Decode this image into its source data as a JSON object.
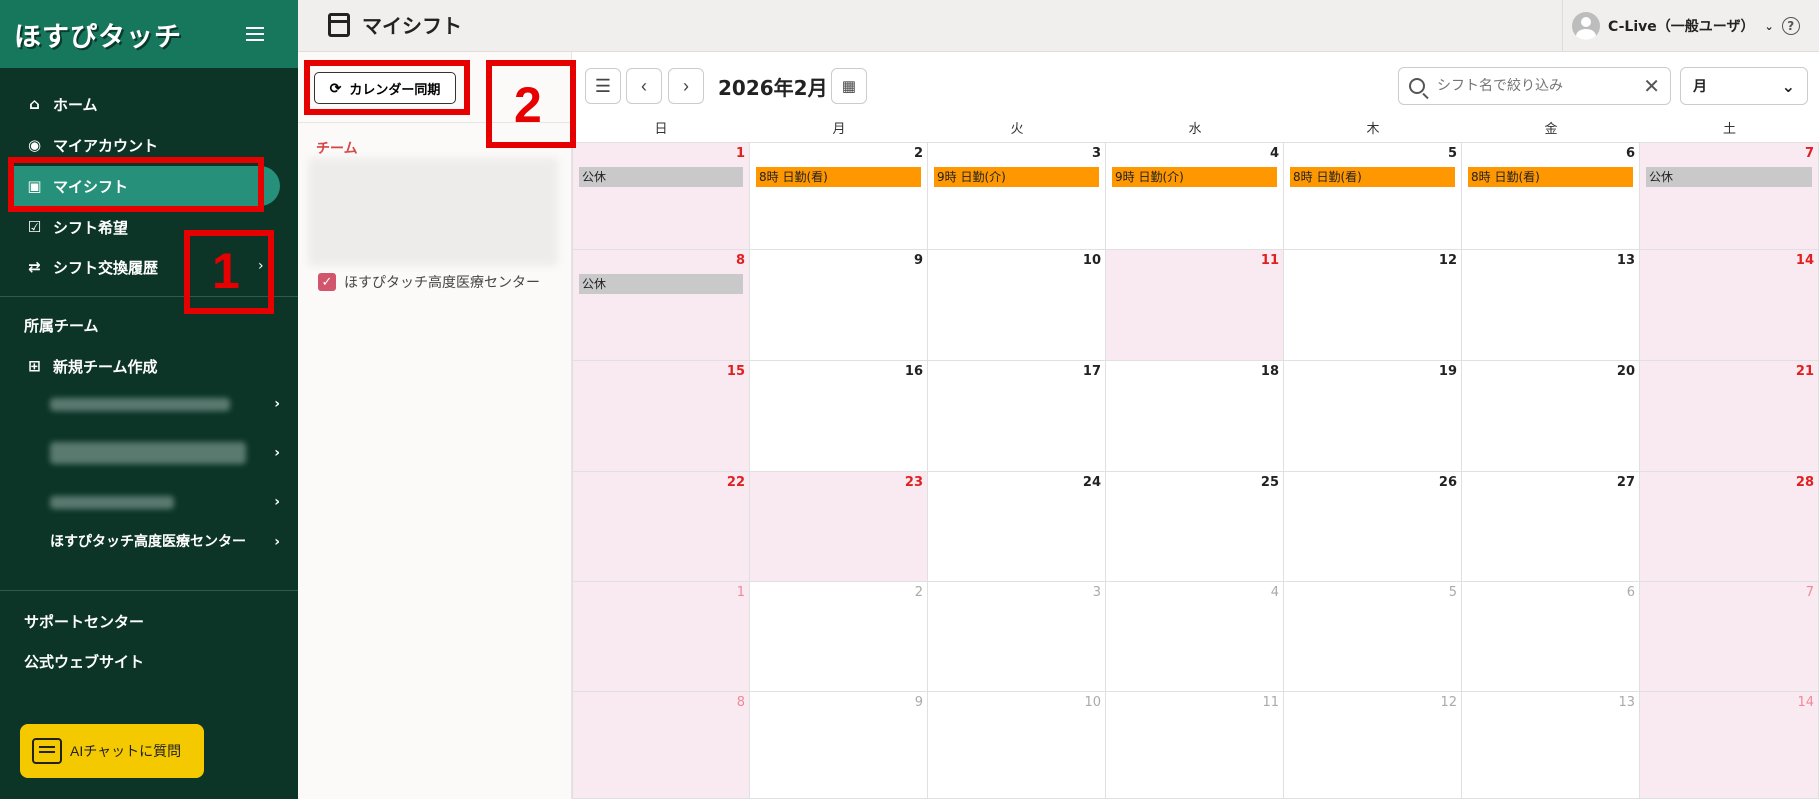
{
  "sidebar": {
    "logo": "ほすぴタッチ",
    "nav": [
      {
        "label": "ホーム",
        "icon": "home-icon"
      },
      {
        "label": "マイアカウント",
        "icon": "account-icon"
      },
      {
        "label": "マイシフト",
        "icon": "id-badge-icon"
      },
      {
        "label": "シフト希望",
        "icon": "checklist-icon"
      },
      {
        "label": "シフト交換履歴",
        "icon": "swap-icon"
      }
    ],
    "team_section": "所属チーム",
    "new_team": "新規チーム作成",
    "teams": [
      "ほすぴタッチ高度医療センター"
    ],
    "support": "サポートセンター",
    "website": "公式ウェブサイト",
    "ai_button": "AIチャットに質問"
  },
  "header": {
    "title": "マイシフト",
    "user": "C-Live（一般ユーザ）",
    "help": "?"
  },
  "left_panel": {
    "sync_button": "カレンダー同期",
    "team_label": "チーム",
    "team_checkbox": "ほすぴタッチ高度医療センター"
  },
  "toolbar": {
    "month": "2026年2月",
    "search_placeholder": "シフト名で絞り込み",
    "view": "月"
  },
  "calendar": {
    "weekdays": [
      "日",
      "月",
      "火",
      "水",
      "木",
      "金",
      "土"
    ],
    "weeks": [
      [
        {
          "d": "1"
        },
        {
          "d": "2"
        },
        {
          "d": "3"
        },
        {
          "d": "4"
        },
        {
          "d": "5"
        },
        {
          "d": "6"
        },
        {
          "d": "7"
        }
      ],
      [
        {
          "d": "8"
        },
        {
          "d": "9"
        },
        {
          "d": "10"
        },
        {
          "d": "11"
        },
        {
          "d": "12"
        },
        {
          "d": "13"
        },
        {
          "d": "14"
        }
      ],
      [
        {
          "d": "15"
        },
        {
          "d": "16"
        },
        {
          "d": "17"
        },
        {
          "d": "18"
        },
        {
          "d": "19"
        },
        {
          "d": "20"
        },
        {
          "d": "21"
        }
      ],
      [
        {
          "d": "22"
        },
        {
          "d": "23"
        },
        {
          "d": "24"
        },
        {
          "d": "25"
        },
        {
          "d": "26"
        },
        {
          "d": "27"
        },
        {
          "d": "28"
        }
      ],
      [
        {
          "d": "1"
        },
        {
          "d": "2"
        },
        {
          "d": "3"
        },
        {
          "d": "4"
        },
        {
          "d": "5"
        },
        {
          "d": "6"
        },
        {
          "d": "7"
        }
      ],
      [
        {
          "d": "8"
        },
        {
          "d": "9"
        },
        {
          "d": "10"
        },
        {
          "d": "11"
        },
        {
          "d": "12"
        },
        {
          "d": "13"
        },
        {
          "d": "14"
        }
      ]
    ],
    "shifts": [
      [
        "公休",
        "8時 日勤(看)",
        "9時 日勤(介)",
        "9時 日勤(介)",
        "8時 日勤(看)",
        "8時 日勤(看)",
        "公休"
      ],
      [
        "公休",
        "",
        "",
        "",
        "",
        "",
        ""
      ]
    ]
  },
  "annotations": {
    "label1": "1",
    "label2": "2"
  }
}
